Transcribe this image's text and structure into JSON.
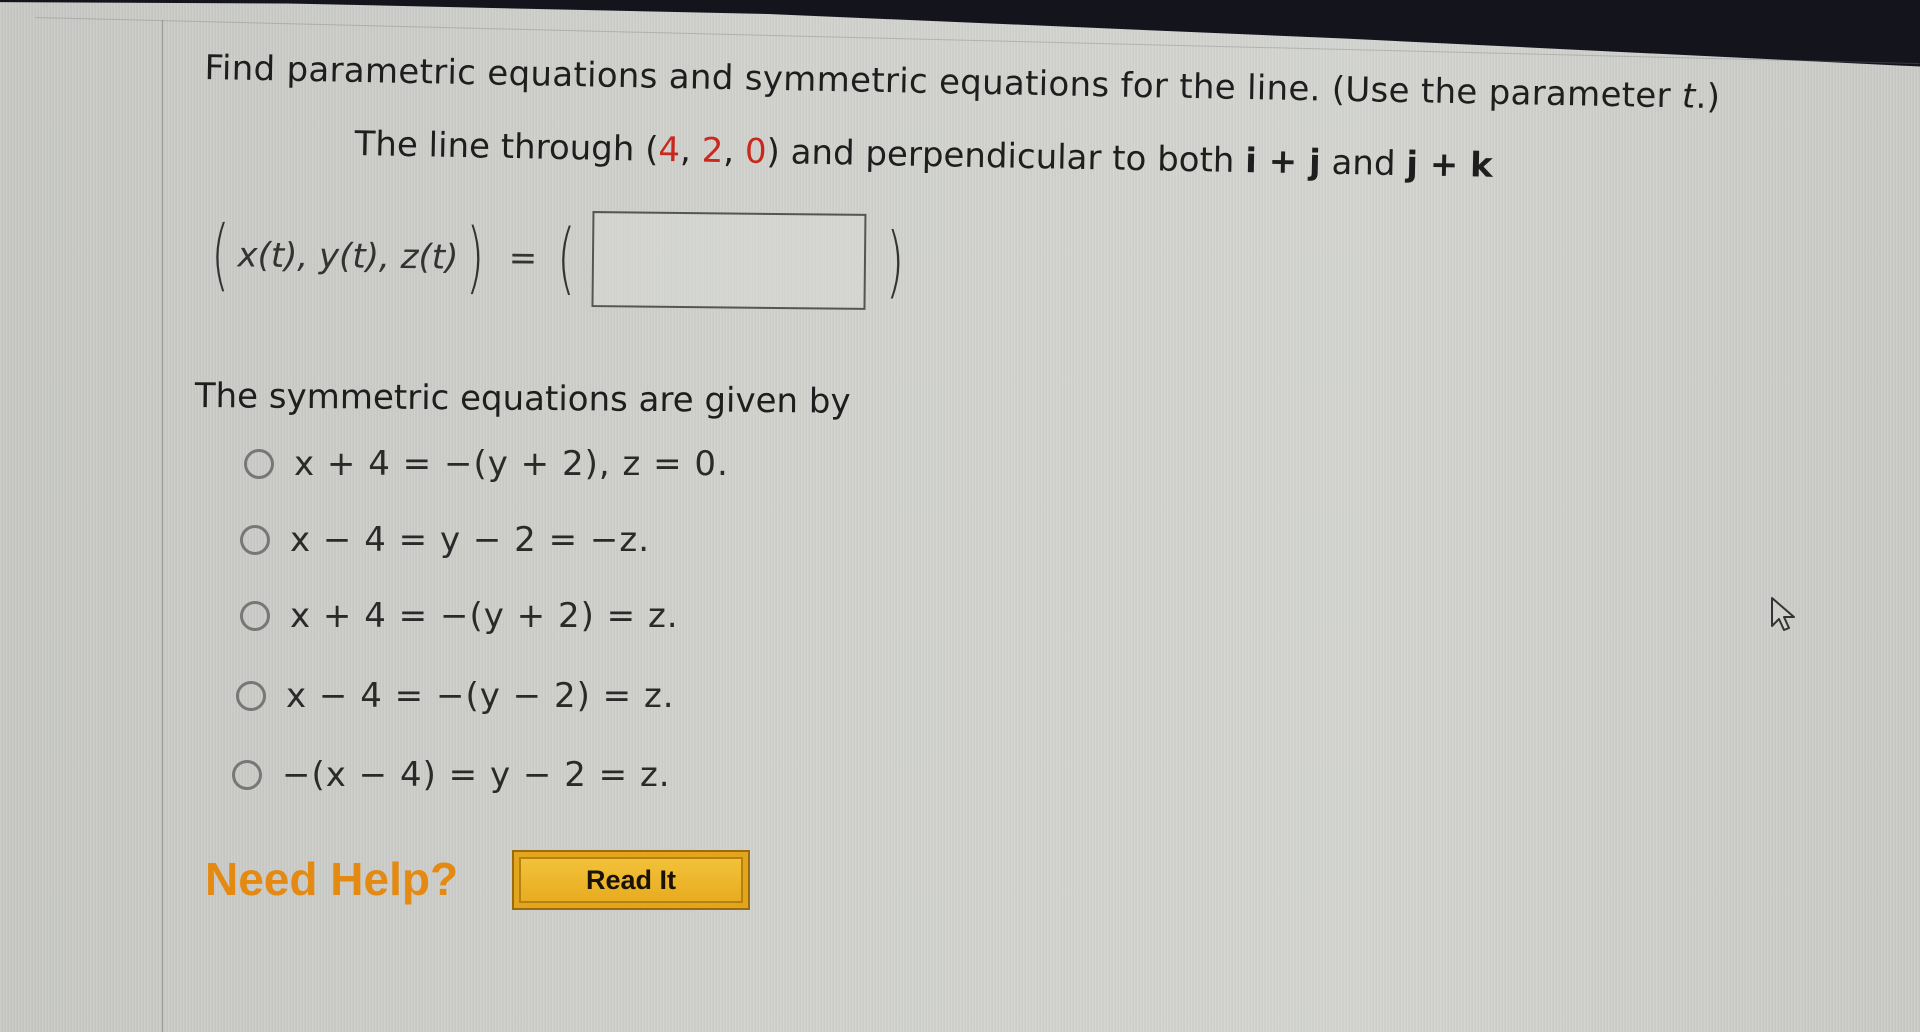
{
  "question": {
    "instruction": "Find parametric equations and symmetric equations for the line. (Use the parameter ",
    "parameter_symbol": "t",
    "instruction_end": ".)",
    "prompt_prefix": "The line through ",
    "point_open": "(",
    "point_x": "4",
    "point_y": "2",
    "point_z": "0",
    "point_close": ")",
    "point_sep": ", ",
    "prompt_middle": " and perpendicular to both ",
    "vector1": "i + j",
    "conj": " and ",
    "vector2": "j + k",
    "point_color": "#c8281e"
  },
  "parametric": {
    "left_expr": "x(t), y(t), z(t)",
    "equals": "=",
    "open_paren": "(",
    "close_paren": ")",
    "input_value": "",
    "input_placeholder": ""
  },
  "symmetric": {
    "heading": "The symmetric equations are given by",
    "options": [
      {
        "label": "x + 4 = −(y + 2), z = 0.",
        "selected": false
      },
      {
        "label": "x − 4 = y − 2 = −z.",
        "selected": false
      },
      {
        "label": "x + 4 = −(y + 2) = z.",
        "selected": false
      },
      {
        "label": "x − 4 = −(y − 2) = z.",
        "selected": false
      },
      {
        "label": "−(x − 4) = y − 2 = z.",
        "selected": false
      }
    ]
  },
  "help": {
    "label": "Need Help?",
    "button_label": "Read It",
    "label_color": "#e48a12",
    "button_color": "#e2a51d"
  },
  "icons": {
    "cursor": "mouse-pointer-arrow"
  }
}
